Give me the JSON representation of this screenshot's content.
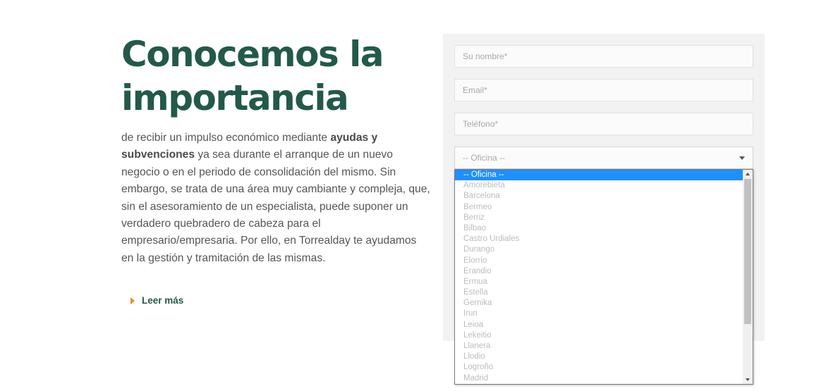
{
  "intro": {
    "heading_line1": "Conocemos la",
    "heading_line2": "importancia",
    "text_part1": "de recibir un impulso económico mediante ",
    "text_bold": "ayudas y subvenciones",
    "text_part2": " ya sea durante el arranque de un nuevo negocio o en el periodo de consolidación del mismo. Sin embargo, se trata de una área muy cambiante y compleja, que, sin el asesoramiento de un especialista, puede suponer un verdadero quebradero de cabeza para el empresario/empresaria. Por ello, en Torrealday te ayudamos en la gestión y tramitación de las mismas.",
    "read_more_label": "Leer más",
    "read_more_icon": "caret-right-icon"
  },
  "form": {
    "name_placeholder": "Su nombre*",
    "email_placeholder": "Email*",
    "phone_placeholder": "Teléfono*",
    "office_selected": "-- Oficina --",
    "office_options": [
      "-- Oficina --",
      "Amorebieta",
      "Barcelona",
      "Bermeo",
      "Berriz",
      "Bilbao",
      "Castro Urdiales",
      "Durango",
      "Elorrio",
      "Erandio",
      "Ermua",
      "Estella",
      "Gernika",
      "Irun",
      "Leioa",
      "Lekeitio",
      "Llanera",
      "Llodio",
      "Logroño",
      "Madrid"
    ]
  },
  "colors": {
    "heading": "#23594a",
    "accent_orange": "#f08a1c",
    "selected_option": "#1e90ff"
  }
}
